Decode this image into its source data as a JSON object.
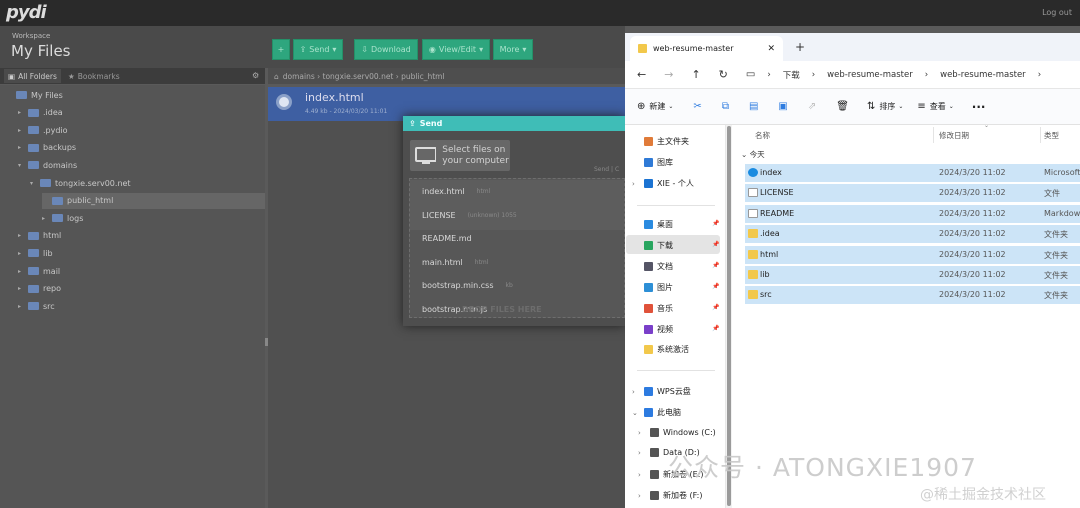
{
  "topbar": {
    "logo": "pydi",
    "logout": "Log out"
  },
  "header": {
    "workspace_label": "Workspace",
    "title": "My Files"
  },
  "toolbar": {
    "send": "Send",
    "download": "Download",
    "view_edit": "View/Edit",
    "more": "More"
  },
  "tabs": {
    "all_folders": "All Folders",
    "bookmarks": "Bookmarks"
  },
  "tree": [
    {
      "label": "My Files",
      "indent": 0,
      "tri": ""
    },
    {
      "label": ".idea",
      "indent": 1,
      "tri": "▸"
    },
    {
      "label": ".pydio",
      "indent": 1,
      "tri": "▸"
    },
    {
      "label": "backups",
      "indent": 1,
      "tri": "▸"
    },
    {
      "label": "domains",
      "indent": 1,
      "tri": "▾"
    },
    {
      "label": "tongxie.serv00.net",
      "indent": 2,
      "tri": "▾"
    },
    {
      "label": "public_html",
      "indent": 3,
      "tri": ""
    },
    {
      "label": "logs",
      "indent": 3,
      "tri": "▸"
    },
    {
      "label": "html",
      "indent": 1,
      "tri": "▸"
    },
    {
      "label": "lib",
      "indent": 1,
      "tri": "▸"
    },
    {
      "label": "mail",
      "indent": 1,
      "tri": "▸"
    },
    {
      "label": "repo",
      "indent": 1,
      "tri": "▸"
    },
    {
      "label": "src",
      "indent": 1,
      "tri": "▸"
    }
  ],
  "breadcrumb": "domains › tongxie.serv00.net › public_html",
  "selected_row": {
    "name": "index.html",
    "meta": "4.49 kb - 2024/03/20 11:01"
  },
  "send_dialog": {
    "title": "Send",
    "select_btn": "Select files on your computer",
    "send_hint": "Send | C",
    "queue": [
      {
        "name": "index.html",
        "size": "html"
      },
      {
        "name": "LICENSE",
        "size": "(unknown) 1055"
      },
      {
        "name": "README.md",
        "size": ""
      },
      {
        "name": "main.html",
        "size": "html"
      },
      {
        "name": "bootstrap.min.css",
        "size": "kb"
      },
      {
        "name": "bootstrap.min.js",
        "size": ""
      }
    ],
    "drop_text": "DROP FILES HERE"
  },
  "explorer": {
    "tab": "web-resume-master",
    "address": [
      "下载",
      "web-resume-master",
      "web-resume-master"
    ],
    "cmd": {
      "new": "新建",
      "sort": "排序",
      "view": "查看"
    },
    "nav": [
      {
        "label": "主文件夹",
        "icon": "home-icon",
        "color": "#e07b39",
        "indent": 0,
        "arrow": ""
      },
      {
        "label": "图库",
        "icon": "gallery-icon",
        "color": "#2f7ad6",
        "indent": 0,
        "arrow": ""
      },
      {
        "label": "XIE - 个人",
        "icon": "cloud-icon",
        "color": "#1b73d2",
        "indent": 0,
        "arrow": "›"
      },
      {
        "label": "桌面",
        "icon": "desktop-icon",
        "color": "#2b8be0",
        "indent": 0,
        "arrow": "",
        "pin": true
      },
      {
        "label": "下载",
        "icon": "download-icon",
        "color": "#28a55f",
        "indent": 0,
        "arrow": "",
        "pin": true,
        "active": true
      },
      {
        "label": "文档",
        "icon": "document-icon",
        "color": "#556",
        "indent": 0,
        "arrow": "",
        "pin": true
      },
      {
        "label": "图片",
        "icon": "picture-icon",
        "color": "#2d8fd6",
        "indent": 0,
        "arrow": "",
        "pin": true
      },
      {
        "label": "音乐",
        "icon": "music-icon",
        "color": "#e0523a",
        "indent": 0,
        "arrow": "",
        "pin": true
      },
      {
        "label": "视频",
        "icon": "video-icon",
        "color": "#7a3fc9",
        "indent": 0,
        "arrow": "",
        "pin": true
      },
      {
        "label": "系统激活",
        "icon": "folder-icon",
        "color": "#f2c84b",
        "indent": 0,
        "arrow": ""
      },
      {
        "label": "WPS云盘",
        "icon": "wps-cloud-icon",
        "color": "#2d7be0",
        "indent": 0,
        "arrow": "›"
      },
      {
        "label": "此电脑",
        "icon": "pc-icon",
        "color": "#2d7be0",
        "indent": 0,
        "arrow": "⌄"
      },
      {
        "label": "Windows (C:)",
        "icon": "drive-icon",
        "color": "#555",
        "indent": 1,
        "arrow": "›"
      },
      {
        "label": "Data (D:)",
        "icon": "drive-icon",
        "color": "#555",
        "indent": 1,
        "arrow": "›"
      },
      {
        "label": "新加卷 (E:)",
        "icon": "drive-icon",
        "color": "#555",
        "indent": 1,
        "arrow": "›"
      },
      {
        "label": "新加卷 (F:)",
        "icon": "drive-icon",
        "color": "#555",
        "indent": 1,
        "arrow": "›"
      }
    ],
    "columns": {
      "name": "名称",
      "date": "修改日期",
      "type": "类型"
    },
    "group": "今天",
    "files": [
      {
        "name": "index",
        "date": "2024/3/20 11:02",
        "type": "Microsoft",
        "icon": "edge-icon",
        "color": "#1a8be0"
      },
      {
        "name": "LICENSE",
        "date": "2024/3/20 11:02",
        "type": "文件",
        "icon": "file-icon",
        "color": "#fff"
      },
      {
        "name": "README",
        "date": "2024/3/20 11:02",
        "type": "Markdow",
        "icon": "markdown-icon",
        "color": "#fff"
      },
      {
        "name": ".idea",
        "date": "2024/3/20 11:02",
        "type": "文件夹",
        "icon": "folder-icon",
        "color": "#f2c84b"
      },
      {
        "name": "html",
        "date": "2024/3/20 11:02",
        "type": "文件夹",
        "icon": "folder-icon",
        "color": "#f2c84b"
      },
      {
        "name": "lib",
        "date": "2024/3/20 11:02",
        "type": "文件夹",
        "icon": "folder-icon",
        "color": "#f2c84b"
      },
      {
        "name": "src",
        "date": "2024/3/20 11:02",
        "type": "文件夹",
        "icon": "folder-icon",
        "color": "#f2c84b"
      }
    ]
  },
  "watermark": {
    "primary": "公众号 · ATONGXIE1907",
    "secondary": "@稀土掘金技术社区"
  }
}
